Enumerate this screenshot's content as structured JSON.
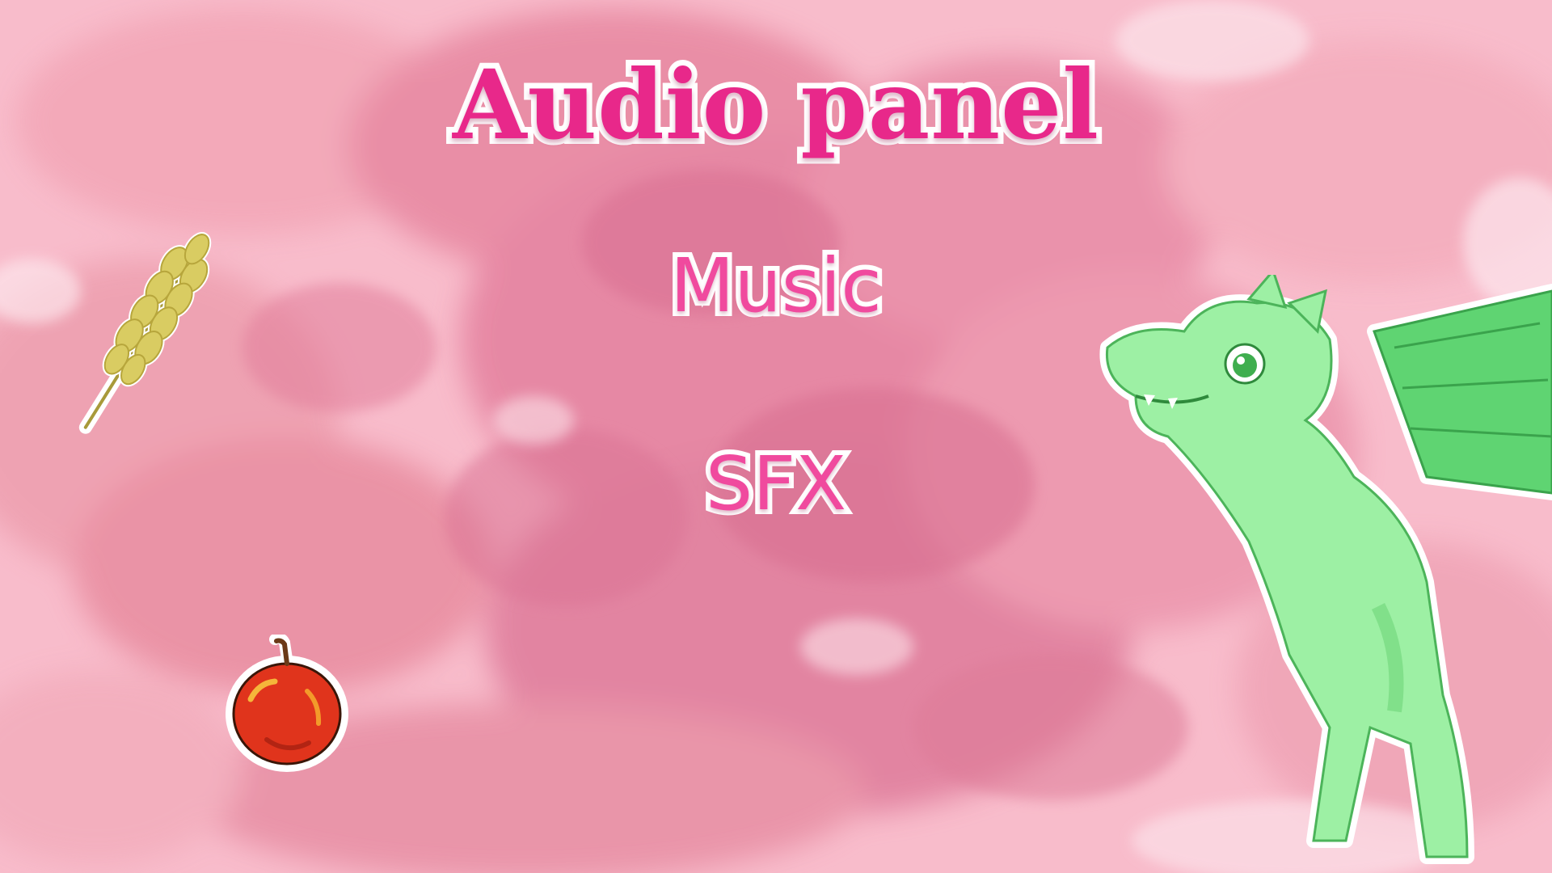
{
  "screen": {
    "title": "Audio panel",
    "background_color": "#f7b7c4",
    "accent_color": "#e8288a"
  },
  "menu": {
    "items": [
      {
        "id": "music",
        "label": "Music"
      },
      {
        "id": "sfx",
        "label": "SFX"
      }
    ]
  },
  "decorations": {
    "wheat": "wheat-sticker-icon",
    "apple": "apple-sticker-icon",
    "dragon": "green-dragon-sticker"
  }
}
